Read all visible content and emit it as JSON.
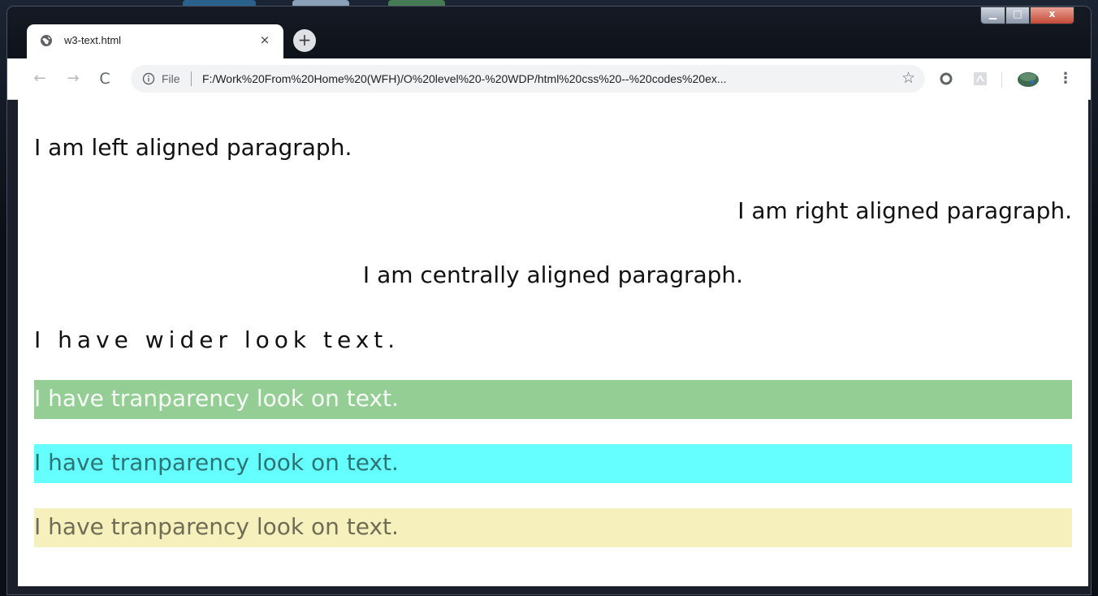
{
  "browser": {
    "tab": {
      "title": "w3-text.html",
      "favicon": "globe-icon",
      "close_glyph": "×"
    },
    "new_tab_glyph": "+",
    "window_controls": {
      "minimize_glyph": "▁",
      "maximize_glyph": "□",
      "close_glyph": "x"
    },
    "nav": {
      "back_glyph": "←",
      "forward_glyph": "→",
      "reload_glyph": "C"
    },
    "omnibox": {
      "scheme_label": "File",
      "url": "F:/Work%20From%20Home%20(WFH)/O%20level%20-%20WDP/html%20css%20--%20codes%20ex...",
      "star_glyph": "☆"
    },
    "menu_glyph": "⋮"
  },
  "page": {
    "paragraphs": {
      "left": "I am left aligned paragraph.",
      "right": "I am right aligned paragraph.",
      "center": "I am centrally aligned paragraph.",
      "wide": "I have wider look text.",
      "green": "I have tranparency look on text.",
      "cyan": "I have tranparency look on text.",
      "yellow": "I have tranparency look on text."
    },
    "colors": {
      "green_bg": "#95ce95",
      "cyan_bg": "#66ffff",
      "yellow_bg": "#f5f0bc"
    }
  }
}
